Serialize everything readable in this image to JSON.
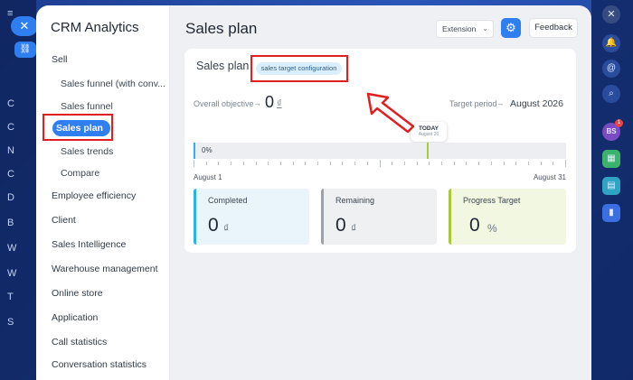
{
  "left_rail": {
    "close_glyph": "✕",
    "link_glyph": "🔗",
    "items": [
      "C",
      "C",
      "N",
      "C",
      "D",
      "B",
      "W",
      "W",
      "T",
      "S"
    ]
  },
  "app": {
    "title": "CRM Analytics"
  },
  "sidebar": {
    "section_sell": "Sell",
    "items": [
      {
        "label": "Sales funnel (with conv...",
        "sub": true
      },
      {
        "label": "Sales funnel",
        "sub": true
      },
      {
        "label": "Sales plan",
        "sub": true,
        "active": true
      },
      {
        "label": "Sales trends",
        "sub": true
      },
      {
        "label": "Compare",
        "sub": true
      }
    ],
    "sections": [
      "Employee efficiency",
      "Client",
      "Sales Intelligence",
      "Warehouse management",
      "Online store",
      "Application",
      "Call statistics",
      "Conversation statistics"
    ]
  },
  "header": {
    "title": "Sales plan",
    "extension_label": "Extension",
    "feedback_label": "Feedback"
  },
  "card": {
    "title": "Sales plan",
    "config_tag": "sales target configuration",
    "overall_label": "Overall objective",
    "overall_arrow": "→",
    "overall_value": "0",
    "currency": "₫",
    "period_label": "Target period",
    "period_dash": "–",
    "period_value": "August 2026",
    "today_label": "TODAY",
    "today_date": "August 20",
    "progress_percent": 0,
    "progress_text": "0%",
    "axis_start": "August 1",
    "axis_end": "August 31",
    "stats": {
      "completed": {
        "label": "Completed",
        "value": "0",
        "unit": "₫"
      },
      "remaining": {
        "label": "Remaining",
        "value": "0",
        "unit": "₫"
      },
      "progress": {
        "label": "Progress Target",
        "value": "0",
        "unit": "%"
      }
    }
  },
  "right_rail": {
    "close_glyph": "✕",
    "avatar_initials": "BS",
    "badge_count": "1"
  },
  "colors": {
    "accent": "#2f7ff0",
    "highlight": "#e02020",
    "completed": "#2fb0e8",
    "progress": "#a9c83a"
  }
}
